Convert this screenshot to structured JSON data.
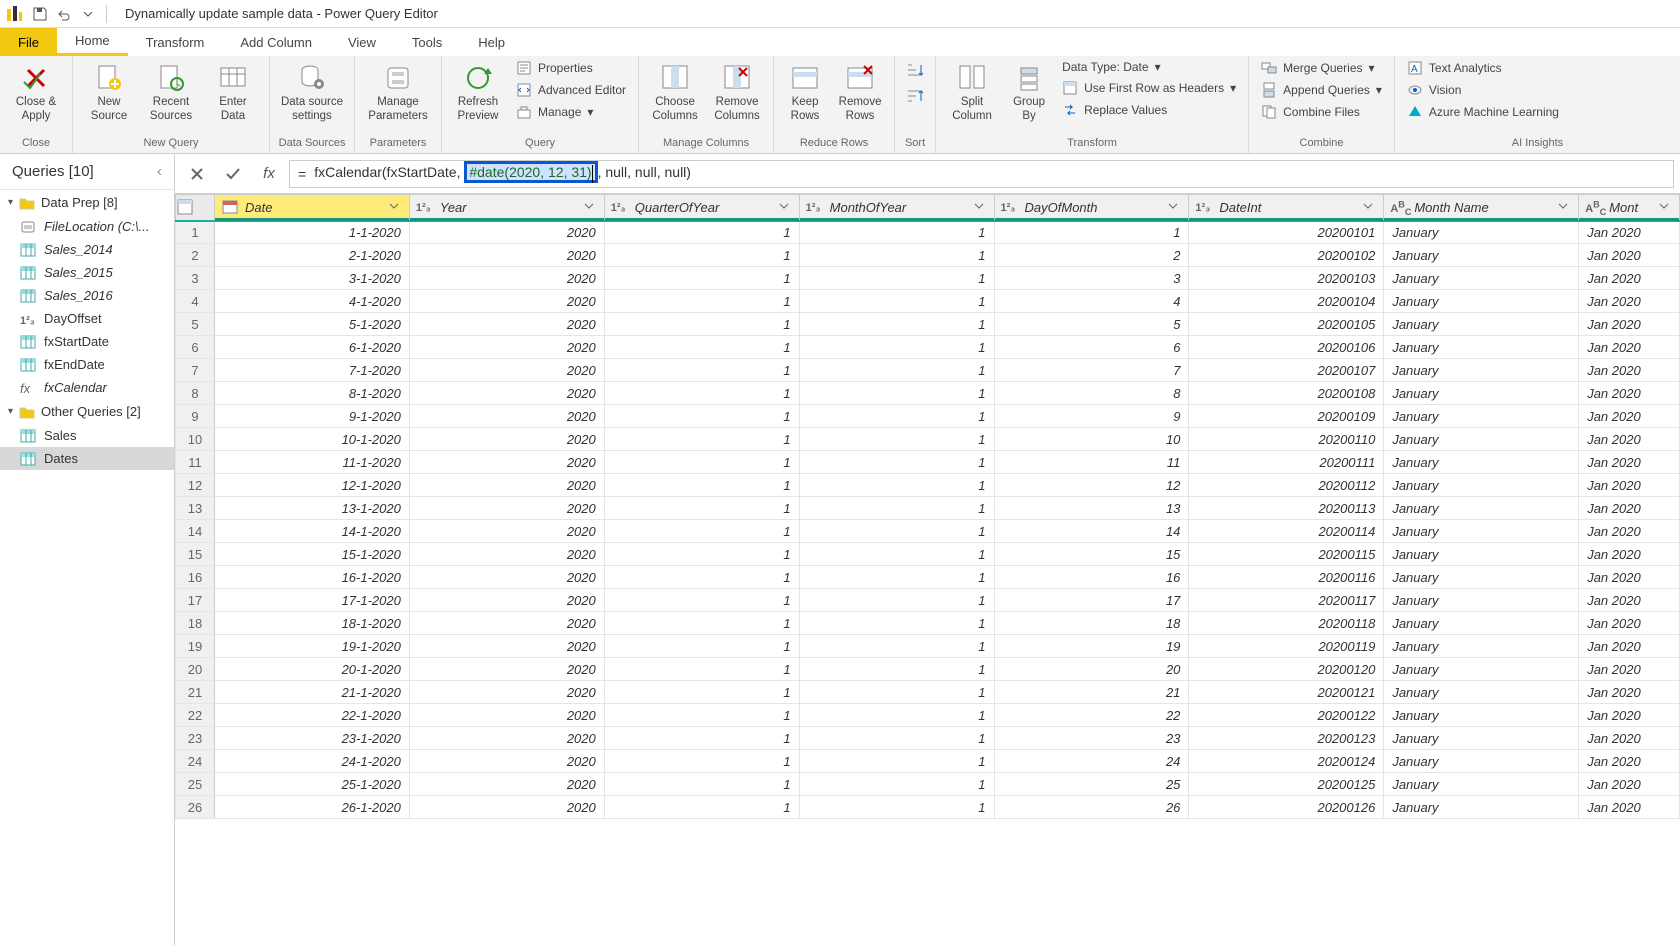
{
  "title": "Dynamically update sample data - Power Query Editor",
  "menu": {
    "file": "File",
    "home": "Home",
    "transform": "Transform",
    "addcolumn": "Add Column",
    "view": "View",
    "tools": "Tools",
    "help": "Help"
  },
  "ribbon": {
    "close": {
      "closeApply": "Close &\nApply",
      "group": "Close"
    },
    "newQuery": {
      "newSource": "New\nSource",
      "recentSources": "Recent\nSources",
      "enterData": "Enter\nData",
      "group": "New Query"
    },
    "dataSources": {
      "settings": "Data source\nsettings",
      "group": "Data Sources"
    },
    "parameters": {
      "manage": "Manage\nParameters",
      "group": "Parameters"
    },
    "query": {
      "refresh": "Refresh\nPreview",
      "properties": "Properties",
      "advanced": "Advanced Editor",
      "manage": "Manage",
      "group": "Query"
    },
    "manageCols": {
      "choose": "Choose\nColumns",
      "remove": "Remove\nColumns",
      "group": "Manage Columns"
    },
    "reduceRows": {
      "keep": "Keep\nRows",
      "remove": "Remove\nRows",
      "group": "Reduce Rows"
    },
    "sort": {
      "group": "Sort"
    },
    "transform": {
      "split": "Split\nColumn",
      "groupBy": "Group\nBy",
      "dataType": "Data Type: Date",
      "firstRow": "Use First Row as Headers",
      "replace": "Replace Values",
      "group": "Transform"
    },
    "combine": {
      "merge": "Merge Queries",
      "append": "Append Queries",
      "combineFiles": "Combine Files",
      "group": "Combine"
    },
    "ai": {
      "textAnalytics": "Text Analytics",
      "vision": "Vision",
      "azureML": "Azure Machine Learning",
      "group": "AI Insights"
    }
  },
  "queries": {
    "header": "Queries [10]",
    "group1": "Data Prep [8]",
    "items1": [
      {
        "name": "FileLocation (C:\\...",
        "type": "param",
        "italic": true
      },
      {
        "name": "Sales_2014",
        "type": "table",
        "italic": true
      },
      {
        "name": "Sales_2015",
        "type": "table",
        "italic": true
      },
      {
        "name": "Sales_2016",
        "type": "table",
        "italic": true
      },
      {
        "name": "DayOffset",
        "type": "num",
        "italic": false
      },
      {
        "name": "fxStartDate",
        "type": "table",
        "italic": false
      },
      {
        "name": "fxEndDate",
        "type": "table",
        "italic": false
      },
      {
        "name": "fxCalendar",
        "type": "fx",
        "italic": true
      }
    ],
    "group2": "Other Queries [2]",
    "items2": [
      {
        "name": "Sales",
        "type": "table",
        "italic": false
      },
      {
        "name": "Dates",
        "type": "table",
        "italic": false,
        "selected": true
      }
    ]
  },
  "formula": {
    "pre": "fxCalendar(fxStartDate, ",
    "hlKw": "#date",
    "hlArgs": "(2020, 12, 31)",
    "post": ", null, null, null)"
  },
  "columns": [
    {
      "name": "Date",
      "type": "date",
      "selected": true
    },
    {
      "name": "Year",
      "type": "num"
    },
    {
      "name": "QuarterOfYear",
      "type": "num"
    },
    {
      "name": "MonthOfYear",
      "type": "num"
    },
    {
      "name": "DayOfMonth",
      "type": "num"
    },
    {
      "name": "DateInt",
      "type": "num"
    },
    {
      "name": "Month Name",
      "type": "text"
    },
    {
      "name": "Mont",
      "type": "text"
    }
  ],
  "rows": [
    [
      "1-1-2020",
      "2020",
      "1",
      "1",
      "1",
      "20200101",
      "January",
      "Jan 2020"
    ],
    [
      "2-1-2020",
      "2020",
      "1",
      "1",
      "2",
      "20200102",
      "January",
      "Jan 2020"
    ],
    [
      "3-1-2020",
      "2020",
      "1",
      "1",
      "3",
      "20200103",
      "January",
      "Jan 2020"
    ],
    [
      "4-1-2020",
      "2020",
      "1",
      "1",
      "4",
      "20200104",
      "January",
      "Jan 2020"
    ],
    [
      "5-1-2020",
      "2020",
      "1",
      "1",
      "5",
      "20200105",
      "January",
      "Jan 2020"
    ],
    [
      "6-1-2020",
      "2020",
      "1",
      "1",
      "6",
      "20200106",
      "January",
      "Jan 2020"
    ],
    [
      "7-1-2020",
      "2020",
      "1",
      "1",
      "7",
      "20200107",
      "January",
      "Jan 2020"
    ],
    [
      "8-1-2020",
      "2020",
      "1",
      "1",
      "8",
      "20200108",
      "January",
      "Jan 2020"
    ],
    [
      "9-1-2020",
      "2020",
      "1",
      "1",
      "9",
      "20200109",
      "January",
      "Jan 2020"
    ],
    [
      "10-1-2020",
      "2020",
      "1",
      "1",
      "10",
      "20200110",
      "January",
      "Jan 2020"
    ],
    [
      "11-1-2020",
      "2020",
      "1",
      "1",
      "11",
      "20200111",
      "January",
      "Jan 2020"
    ],
    [
      "12-1-2020",
      "2020",
      "1",
      "1",
      "12",
      "20200112",
      "January",
      "Jan 2020"
    ],
    [
      "13-1-2020",
      "2020",
      "1",
      "1",
      "13",
      "20200113",
      "January",
      "Jan 2020"
    ],
    [
      "14-1-2020",
      "2020",
      "1",
      "1",
      "14",
      "20200114",
      "January",
      "Jan 2020"
    ],
    [
      "15-1-2020",
      "2020",
      "1",
      "1",
      "15",
      "20200115",
      "January",
      "Jan 2020"
    ],
    [
      "16-1-2020",
      "2020",
      "1",
      "1",
      "16",
      "20200116",
      "January",
      "Jan 2020"
    ],
    [
      "17-1-2020",
      "2020",
      "1",
      "1",
      "17",
      "20200117",
      "January",
      "Jan 2020"
    ],
    [
      "18-1-2020",
      "2020",
      "1",
      "1",
      "18",
      "20200118",
      "January",
      "Jan 2020"
    ],
    [
      "19-1-2020",
      "2020",
      "1",
      "1",
      "19",
      "20200119",
      "January",
      "Jan 2020"
    ],
    [
      "20-1-2020",
      "2020",
      "1",
      "1",
      "20",
      "20200120",
      "January",
      "Jan 2020"
    ],
    [
      "21-1-2020",
      "2020",
      "1",
      "1",
      "21",
      "20200121",
      "January",
      "Jan 2020"
    ],
    [
      "22-1-2020",
      "2020",
      "1",
      "1",
      "22",
      "20200122",
      "January",
      "Jan 2020"
    ],
    [
      "23-1-2020",
      "2020",
      "1",
      "1",
      "23",
      "20200123",
      "January",
      "Jan 2020"
    ],
    [
      "24-1-2020",
      "2020",
      "1",
      "1",
      "24",
      "20200124",
      "January",
      "Jan 2020"
    ],
    [
      "25-1-2020",
      "2020",
      "1",
      "1",
      "25",
      "20200125",
      "January",
      "Jan 2020"
    ],
    [
      "26-1-2020",
      "2020",
      "1",
      "1",
      "26",
      "20200126",
      "January",
      "Jan 2020"
    ]
  ]
}
